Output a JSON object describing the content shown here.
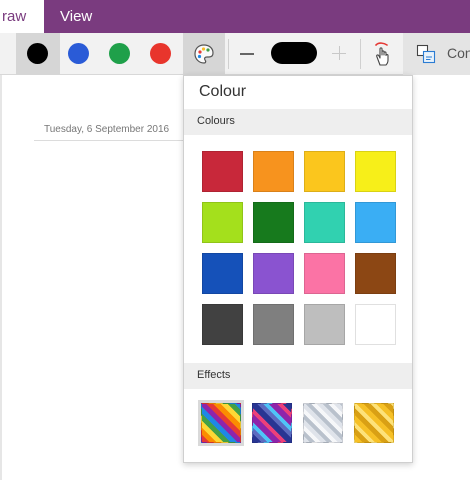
{
  "ribbon": {
    "tabs": [
      {
        "label": "raw",
        "active": true
      },
      {
        "label": "View",
        "active": false
      }
    ]
  },
  "toolbar": {
    "pen_colors": [
      {
        "name": "black",
        "hex": "#000000",
        "selected": true
      },
      {
        "name": "blue",
        "hex": "#2a5bd7"
      },
      {
        "name": "green",
        "hex": "#1fa04a"
      },
      {
        "name": "red",
        "hex": "#e8352c"
      }
    ],
    "palette_icon": "palette-icon",
    "thickness_current_hex": "#000000",
    "convert_label": "Con"
  },
  "page": {
    "date": "Tuesday, 6 September 2016"
  },
  "colour_panel": {
    "title": "Colour",
    "colours_header": "Colours",
    "colours": [
      "#c8283a",
      "#f7931e",
      "#fbc61d",
      "#f7ef19",
      "#a4e01c",
      "#177a1d",
      "#31d1b0",
      "#3aaef4",
      "#1551b9",
      "#8a53d0",
      "#fb73a5",
      "#8c4714",
      "#414141",
      "#7f7f7f",
      "#bebebe",
      "#ffffff"
    ],
    "effects_header": "Effects",
    "effects": [
      {
        "name": "rainbow",
        "selected": true
      },
      {
        "name": "galaxy"
      },
      {
        "name": "silver"
      },
      {
        "name": "gold"
      }
    ]
  }
}
